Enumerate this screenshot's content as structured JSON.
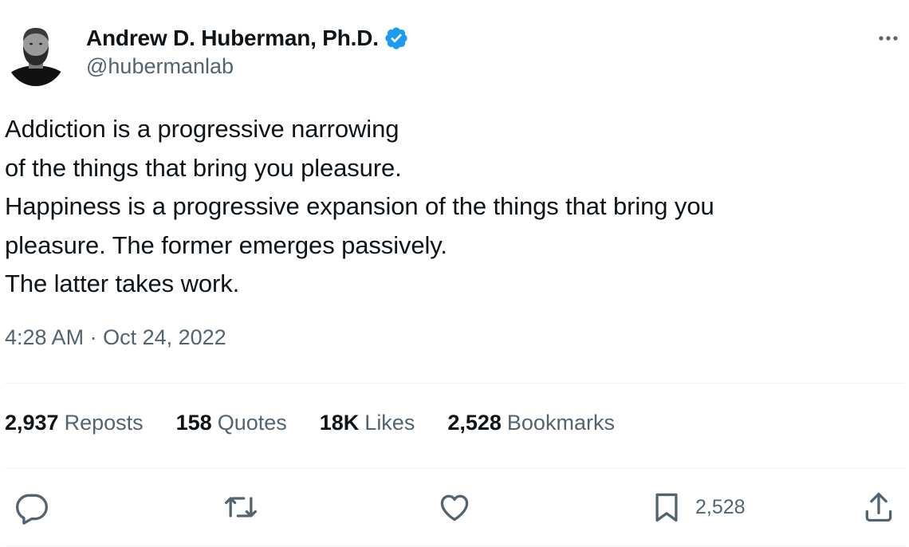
{
  "author": {
    "display_name": "Andrew D. Huberman, Ph.D.",
    "handle": "@hubermanlab",
    "verified": true,
    "verified_color": "#1d9bf0"
  },
  "tweet": {
    "lines": [
      "Addiction is a progressive narrowing",
      "of the things that bring you pleasure.",
      "Happiness is a progressive expansion of the things that bring you",
      "pleasure. The former emerges passively.",
      "The latter takes work."
    ],
    "time": "4:28 AM",
    "separator": "·",
    "date": "Oct 24, 2022"
  },
  "stats": [
    {
      "count": "2,937",
      "label": "Reposts"
    },
    {
      "count": "158",
      "label": "Quotes"
    },
    {
      "count": "18K",
      "label": "Likes"
    },
    {
      "count": "2,528",
      "label": "Bookmarks"
    }
  ],
  "actions": {
    "bookmark_count": "2,528",
    "icons": [
      "reply-icon",
      "repost-icon",
      "like-icon",
      "bookmark-icon",
      "share-icon"
    ]
  },
  "colors": {
    "text_primary": "#0f1419",
    "text_secondary": "#536471",
    "divider": "#eff3f4"
  }
}
